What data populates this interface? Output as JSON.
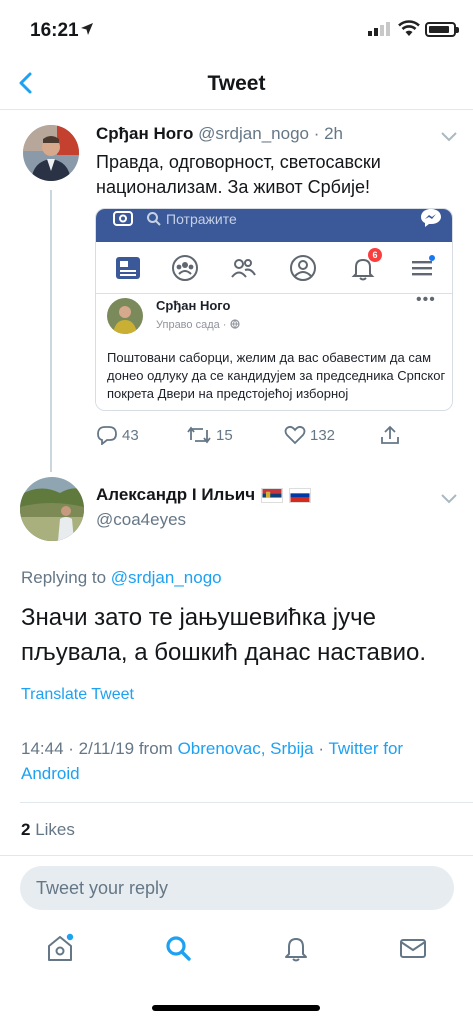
{
  "status": {
    "time": "16:21",
    "battery_level": 0.85
  },
  "nav": {
    "title": "Tweet"
  },
  "parent_tweet": {
    "author_name": "Срђан Ного",
    "handle": "@srdjan_nogo",
    "age": "· 2h",
    "text": "Правда, одговорност, светосавски национализам. За живот Србије!",
    "embed": {
      "search_placeholder": "Потражите",
      "notification_badge": "6",
      "post_author": "Срђан Ного",
      "post_meta": "Управо сада · ",
      "post_text": "Поштовани саборци, желим да вас обавестим да сам донео одлуку да се кандидујем за председника Српског покрета Двери на предстојећој изборној"
    },
    "replies": "43",
    "retweets": "15",
    "likes": "132"
  },
  "main_tweet": {
    "author_name": "Александр I Ильич",
    "handle": "@coa4eyes",
    "replying_prefix": "Replying to ",
    "replying_to": "@srdjan_nogo",
    "text": "Значи зато те јањушевићка јуче пљувала, а бошкић данас наставио.",
    "translate_label": "Translate Tweet",
    "timestamp": "14:44 · 2/11/19 from ",
    "location": "Obrenovac, Srbija",
    "source_sep": " · ",
    "source": "Twitter for Android",
    "likes_count": "2",
    "likes_label": " Likes"
  },
  "reply": {
    "placeholder": "Tweet your reply"
  },
  "colors": {
    "accent": "#1da1f2",
    "muted": "#657786",
    "facebook_blue": "#3b5998"
  }
}
